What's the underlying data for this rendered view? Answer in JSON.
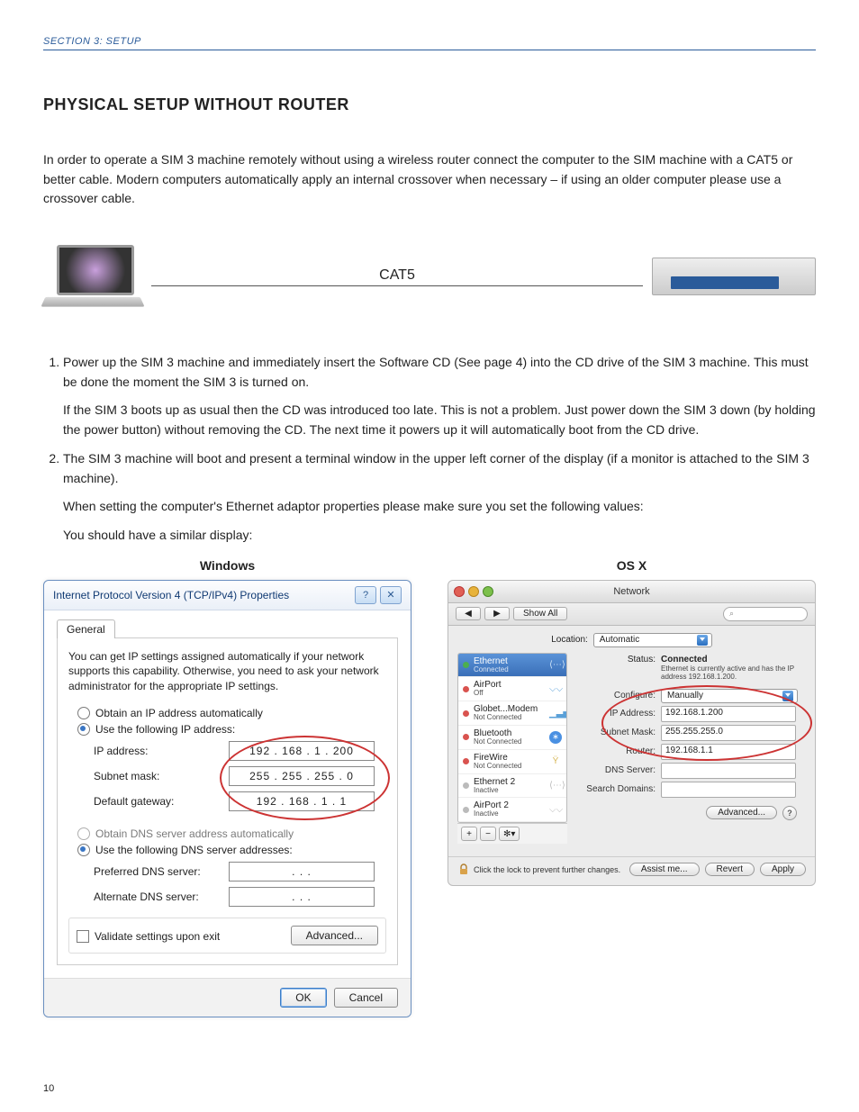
{
  "header": {
    "section": "SECTION 3: SETUP"
  },
  "page_number": "10",
  "title": "PHYSICAL SETUP WITHOUT ROUTER",
  "intro": "In order to operate a SIM 3 machine remotely without using a wireless router connect the computer to the SIM machine with a CAT5 or better cable. Modern computers automatically apply an internal crossover when necessary – if using an older computer please use a crossover cable.",
  "diagram": {
    "cable_label": "CAT5"
  },
  "steps": {
    "s1a": "Power up the SIM 3 machine and immediately insert the Software CD (See page 4) into the CD drive of the SIM 3 machine. This must be done the moment the SIM 3 is turned on.",
    "s1b": "If the SIM 3 boots up as usual then the CD was introduced too late. This is not a problem. Just power down the SIM 3 down (by holding the power button) without removing the CD. The next time it powers up it will automatically boot from the CD drive.",
    "s2a": "The SIM 3 machine will boot and present a terminal window in the upper left corner of the display (if a monitor is attached to the SIM 3 machine).",
    "s2b": "When setting the computer's Ethernet adaptor properties please make sure you set the following values:",
    "s2c": "You should have a similar display:"
  },
  "os_labels": {
    "win": "Windows",
    "osx": "OS X"
  },
  "windows": {
    "title": "Internet Protocol Version 4 (TCP/IPv4) Properties",
    "tab": "General",
    "desc": "You can get IP settings assigned automatically if your network supports this capability. Otherwise, you need to ask your network administrator for the appropriate IP settings.",
    "radio_auto_ip": "Obtain an IP address automatically",
    "radio_use_ip": "Use the following IP address:",
    "ip_label": "IP address:",
    "ip_value": "192 . 168 .   1   . 200",
    "subnet_label": "Subnet mask:",
    "subnet_value": "255 . 255 . 255 .   0",
    "gateway_label": "Default gateway:",
    "gateway_value": "192 . 168 .   1   .   1",
    "radio_auto_dns": "Obtain DNS server address automatically",
    "radio_use_dns": "Use the following DNS server addresses:",
    "pref_dns_label": "Preferred DNS server:",
    "pref_dns_value": ".       .       .",
    "alt_dns_label": "Alternate DNS server:",
    "alt_dns_value": ".       .       .",
    "validate": "Validate settings upon exit",
    "advanced": "Advanced...",
    "ok": "OK",
    "cancel": "Cancel"
  },
  "osx": {
    "window_title": "Network",
    "nav_back": "◀",
    "nav_fwd": "▶",
    "show_all": "Show All",
    "location_label": "Location:",
    "location_value": "Automatic",
    "sidebar": [
      {
        "name": "Ethernet",
        "sub": "Connected",
        "dot": "green",
        "glyph": "⟨⋯⟩",
        "sel": true
      },
      {
        "name": "AirPort",
        "sub": "Off",
        "dot": "red",
        "glyph": "wifi"
      },
      {
        "name": "Globet...Modem",
        "sub": "Not Connected",
        "dot": "red",
        "glyph": "signal"
      },
      {
        "name": "Bluetooth",
        "sub": "Not Connected",
        "dot": "red",
        "glyph": "bt"
      },
      {
        "name": "FireWire",
        "sub": "Not Connected",
        "dot": "red",
        "glyph": "fw"
      },
      {
        "name": "Ethernet 2",
        "sub": "Inactive",
        "dot": "grey",
        "glyph": "lr"
      },
      {
        "name": "AirPort 2",
        "sub": "Inactive",
        "dot": "grey",
        "glyph": "wifi-off"
      }
    ],
    "side_add": "+",
    "side_remove": "−",
    "side_gear": "✻▾",
    "status_label": "Status:",
    "status_value": "Connected",
    "status_sub": "Ethernet is currently active and has the IP address 192.168.1.200.",
    "configure_label": "Configure:",
    "configure_value": "Manually",
    "ip_label": "IP Address:",
    "ip_value": "192.168.1.200",
    "subnet_label": "Subnet Mask:",
    "subnet_value": "255.255.255.0",
    "router_label": "Router:",
    "router_value": "192.168.1.1",
    "dns_label": "DNS Server:",
    "search_label": "Search Domains:",
    "advanced": "Advanced...",
    "help": "?",
    "lock_text": "Click the lock to prevent further changes.",
    "assist": "Assist me...",
    "revert": "Revert",
    "apply": "Apply"
  }
}
